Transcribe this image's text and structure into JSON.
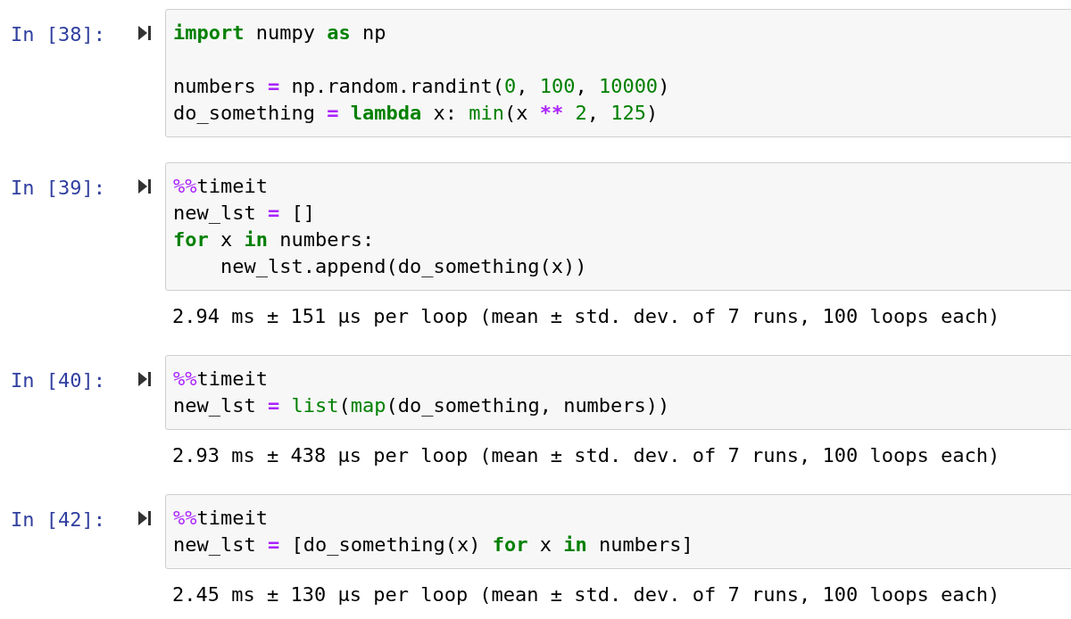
{
  "cells": [
    {
      "prompt": "In [38]:",
      "lines": [
        {
          "tokens": [
            {
              "kind": "kw",
              "text": "import"
            },
            {
              "kind": "plain",
              "text": " numpy "
            },
            {
              "kind": "kw",
              "text": "as"
            },
            {
              "kind": "plain",
              "text": " np"
            }
          ]
        },
        {
          "gap_before": true,
          "tokens": [
            {
              "kind": "plain",
              "text": "numbers "
            },
            {
              "kind": "op",
              "text": "="
            },
            {
              "kind": "plain",
              "text": " np.random.randint("
            },
            {
              "kind": "num",
              "text": "0"
            },
            {
              "kind": "plain",
              "text": ", "
            },
            {
              "kind": "num",
              "text": "100"
            },
            {
              "kind": "plain",
              "text": ", "
            },
            {
              "kind": "num",
              "text": "10000"
            },
            {
              "kind": "plain",
              "text": ")"
            }
          ]
        },
        {
          "tokens": [
            {
              "kind": "plain",
              "text": "do_something "
            },
            {
              "kind": "op",
              "text": "= "
            },
            {
              "kind": "kw",
              "text": "lambda"
            },
            {
              "kind": "plain",
              "text": " x: "
            },
            {
              "kind": "builtin",
              "text": "min"
            },
            {
              "kind": "plain",
              "text": "(x "
            },
            {
              "kind": "op",
              "text": "** "
            },
            {
              "kind": "num",
              "text": "2"
            },
            {
              "kind": "plain",
              "text": ", "
            },
            {
              "kind": "num",
              "text": "125"
            },
            {
              "kind": "plain",
              "text": ")"
            }
          ]
        }
      ]
    },
    {
      "prompt": "In [39]:",
      "lines": [
        {
          "tokens": [
            {
              "kind": "magic",
              "text": "%%"
            },
            {
              "kind": "plain",
              "text": "timeit"
            }
          ]
        },
        {
          "tokens": [
            {
              "kind": "plain",
              "text": "new_lst "
            },
            {
              "kind": "op",
              "text": "="
            },
            {
              "kind": "plain",
              "text": " []"
            }
          ]
        },
        {
          "tokens": [
            {
              "kind": "kw",
              "text": "for"
            },
            {
              "kind": "plain",
              "text": " x "
            },
            {
              "kind": "kw",
              "text": "in"
            },
            {
              "kind": "plain",
              "text": " numbers:"
            }
          ]
        },
        {
          "tokens": [
            {
              "kind": "plain",
              "text": "    new_lst.append(do_something(x))"
            }
          ]
        }
      ],
      "output": "2.94 ms ± 151 µs per loop (mean ± std. dev. of 7 runs, 100 loops each)"
    },
    {
      "prompt": "In [40]:",
      "lines": [
        {
          "tokens": [
            {
              "kind": "magic",
              "text": "%%"
            },
            {
              "kind": "plain",
              "text": "timeit"
            }
          ]
        },
        {
          "tokens": [
            {
              "kind": "plain",
              "text": "new_lst "
            },
            {
              "kind": "op",
              "text": "= "
            },
            {
              "kind": "builtin",
              "text": "list"
            },
            {
              "kind": "plain",
              "text": "("
            },
            {
              "kind": "builtin",
              "text": "map"
            },
            {
              "kind": "plain",
              "text": "(do_something, numbers))"
            }
          ]
        }
      ],
      "output": "2.93 ms ± 438 µs per loop (mean ± std. dev. of 7 runs, 100 loops each)"
    },
    {
      "prompt": "In [42]:",
      "lines": [
        {
          "tokens": [
            {
              "kind": "magic",
              "text": "%%"
            },
            {
              "kind": "plain",
              "text": "timeit"
            }
          ]
        },
        {
          "tokens": [
            {
              "kind": "plain",
              "text": "new_lst "
            },
            {
              "kind": "op",
              "text": "="
            },
            {
              "kind": "plain",
              "text": " [do_something(x) "
            },
            {
              "kind": "kw",
              "text": "for"
            },
            {
              "kind": "plain",
              "text": " x "
            },
            {
              "kind": "kw",
              "text": "in"
            },
            {
              "kind": "plain",
              "text": " numbers]"
            }
          ]
        }
      ],
      "output": "2.45 ms ± 130 µs per loop (mean ± std. dev. of 7 runs, 100 loops each)"
    }
  ]
}
